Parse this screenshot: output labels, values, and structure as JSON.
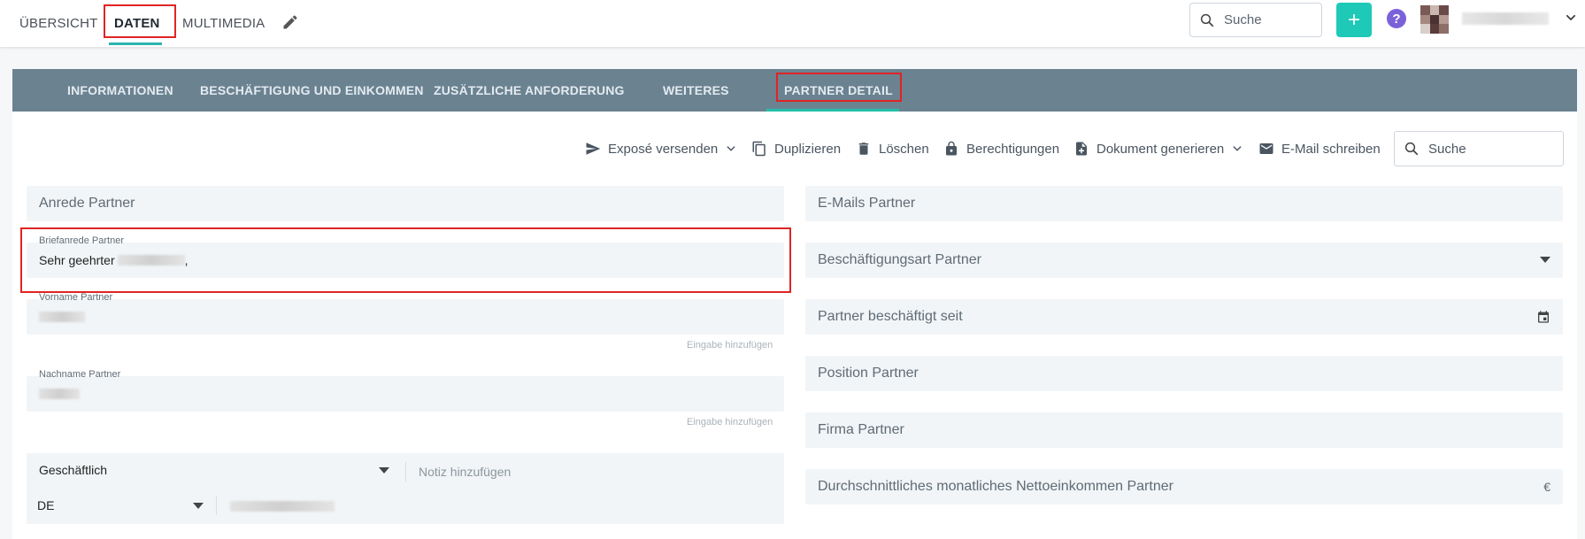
{
  "top_tabs": [
    {
      "label": "ÜBERSICHT"
    },
    {
      "label": "DATEN"
    },
    {
      "label": "MULTIMEDIA"
    }
  ],
  "top_search": {
    "placeholder": "Suche"
  },
  "icons": {
    "edit": "pencil-icon",
    "search": "search-icon",
    "add": "plus-icon",
    "help": "question-icon",
    "user_menu": "chevron-down-icon"
  },
  "colors": {
    "accent": "#1ec9b7",
    "help": "#7b61d9",
    "section_bar": "#6b8291",
    "highlight_box": "#e02424"
  },
  "section_tabs": [
    {
      "label": "INFORMATIONEN"
    },
    {
      "label": "BESCHÄFTIGUNG UND EINKOMMEN"
    },
    {
      "label": "ZUSÄTZLICHE ANFORDERUNG"
    },
    {
      "label": "WEITERES"
    },
    {
      "label": "PARTNER DETAIL"
    }
  ],
  "actions": {
    "expose": "Exposé versenden",
    "duplicate": "Duplizieren",
    "delete": "Löschen",
    "permissions": "Berechtigungen",
    "generate_doc": "Dokument generieren",
    "email": "E-Mail schreiben",
    "search_placeholder": "Suche"
  },
  "left_fields": {
    "anrede": {
      "placeholder": "Anrede Partner"
    },
    "briefanrede": {
      "label": "Briefanrede Partner",
      "value_prefix": "Sehr geehrter",
      "value_suffix": ","
    },
    "vorname": {
      "label": "Vorname Partner",
      "hint": "Eingabe hinzufügen"
    },
    "nachname": {
      "label": "Nachname Partner",
      "hint": "Eingabe hinzufügen"
    },
    "phone": {
      "type": "Geschäftlich",
      "note_placeholder": "Notiz hinzufügen",
      "country": "DE"
    }
  },
  "right_fields": {
    "emails": "E-Mails Partner",
    "employment_type": "Beschäftigungsart Partner",
    "employed_since": "Partner beschäftigt seit",
    "position": "Position Partner",
    "company": "Firma Partner",
    "income": "Durchschnittliches monatliches Nettoeinkommen Partner",
    "currency": "€"
  }
}
